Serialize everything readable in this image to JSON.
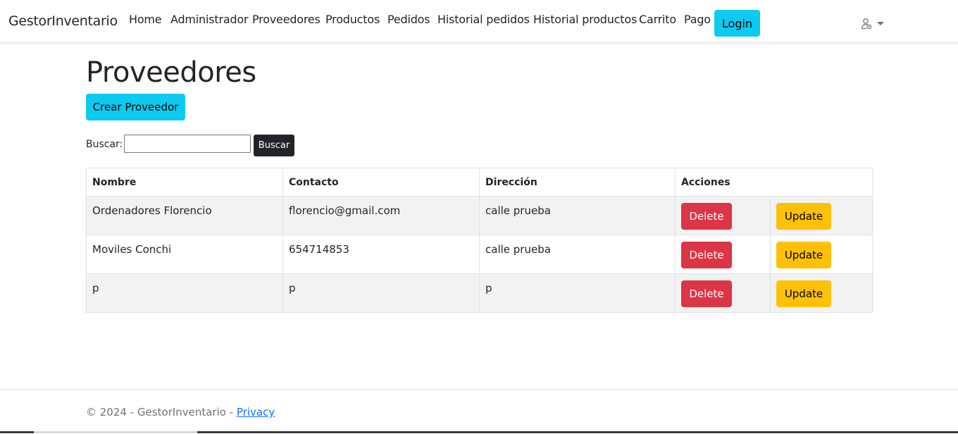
{
  "navbar": {
    "brand": "GestorInventario",
    "links": [
      "Home",
      "Administrador",
      "Proveedores",
      "Productos",
      "Pedidos",
      "Historial pedidos",
      "Historial productos",
      "Carrito",
      "Pago"
    ],
    "login_label": "Login",
    "user_menu_icon": "user-gear-icon",
    "dropdown_icon": "caret-down-icon"
  },
  "main": {
    "title": "Proveedores",
    "create_button": "Crear Proveedor",
    "search": {
      "label": "Buscar:",
      "value": "",
      "placeholder": "",
      "button": "Buscar"
    },
    "table": {
      "headers": [
        "Nombre",
        "Contacto",
        "Dirección",
        "Acciones"
      ],
      "rows": [
        {
          "nombre": "Ordenadores Florencio",
          "contacto": "florencio@gmail.com",
          "direccion": "calle prueba"
        },
        {
          "nombre": "Moviles Conchi",
          "contacto": "654714853",
          "direccion": "calle prueba"
        },
        {
          "nombre": "p",
          "contacto": "p",
          "direccion": "p"
        }
      ],
      "delete_label": "Delete",
      "update_label": "Update"
    }
  },
  "footer": {
    "copyright": "© 2024 - GestorInventario - ",
    "privacy": "Privacy"
  },
  "colors": {
    "info": "#0dcaf0",
    "danger": "#dc3545",
    "warning": "#ffc107",
    "dark": "#212529",
    "link": "#0d6efd",
    "stripe": "#f2f2f2"
  }
}
